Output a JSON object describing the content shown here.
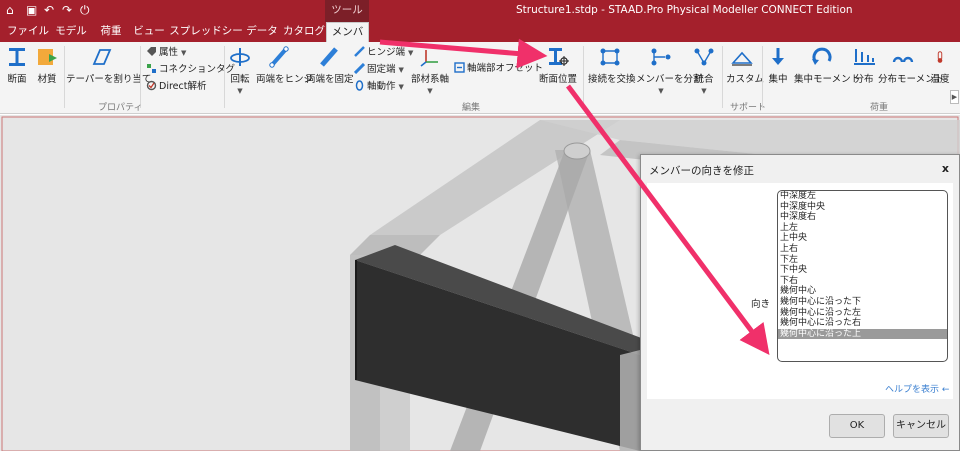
{
  "app": {
    "title": "Structure1.stdp - STAAD.Pro Physical Modeller CONNECT Edition",
    "context_tab": "ツール"
  },
  "tabs": [
    "ファイル",
    "モデル",
    "荷重",
    "ビュー",
    "スプレッドシート",
    "データ",
    "カタログ",
    "メンバー"
  ],
  "ribbon": {
    "properties": {
      "section_label": "断面",
      "material_label": "材質",
      "taper_label": "テーパーを割り当て",
      "attribute_label": "属性",
      "connection_tag_label": "コネクションタグ",
      "direct_analysis_label": "Direct解析",
      "group_label": "プロパティ"
    },
    "edit": {
      "rotate_label": "回転",
      "end_hinge_label": "両端をヒンジ",
      "end_fixed_label": "両端を固定",
      "hinge_end_label": "ヒンジ端",
      "fixed_end_label": "固定端",
      "axial_action_label": "軸動作",
      "member_axis_label": "部材系軸",
      "end_offset_label": "軸端部オフセット",
      "section_position_label": "断面位置",
      "swap_connection_label": "接続を交換",
      "split_member_label": "メンバーを分割",
      "merge_label": "統合",
      "group_label": "編集"
    },
    "support": {
      "custom_label": "カスタム",
      "group_label": "サポート"
    },
    "load": {
      "concentrated_label": "集中",
      "concentrated_moment_label": "集中モーメント",
      "distributed_label": "分布",
      "distributed_moment_label": "分布モーメント",
      "temperature_label": "温度",
      "group_label": "荷重"
    }
  },
  "dialog": {
    "title": "メンバーの向きを修正",
    "close": "x",
    "orientation_label": "向き",
    "options": [
      "中深度左",
      "中深度中央",
      "中深度右",
      "上左",
      "上中央",
      "上右",
      "下左",
      "下中央",
      "下右",
      "幾何中心",
      "幾何中心に沿った下",
      "幾何中心に沿った左",
      "幾何中心に沿った右",
      "幾何中心に沿った上"
    ],
    "selected_index": 13,
    "help_link": "ヘルプを表示 ←",
    "ok_label": "OK",
    "cancel_label": "キャンセル"
  },
  "colors": {
    "title_bar": "#a4202c",
    "ribbon_bg": "#f4f4f4",
    "annotation_arrow": "#f0306a",
    "icon_blue": "#1f6fc9",
    "selected_item": "#9a9a9a"
  },
  "icons": [
    "app-logo-icon",
    "save-icon",
    "undo-icon",
    "redo-icon",
    "power-icon",
    "section-icon",
    "material-icon",
    "taper-icon",
    "attribute-icon",
    "connection-tag-icon",
    "direct-analysis-icon",
    "rotate-icon",
    "end-hinge-icon",
    "end-fixed-icon",
    "hinge-end-icon",
    "fixed-end-icon",
    "axial-action-icon",
    "member-axis-icon",
    "end-offset-icon",
    "section-position-icon",
    "swap-connection-icon",
    "split-member-icon",
    "merge-icon",
    "custom-support-icon",
    "concentrated-load-icon",
    "concentrated-moment-icon",
    "distributed-load-icon",
    "distributed-moment-icon",
    "temperature-icon"
  ]
}
